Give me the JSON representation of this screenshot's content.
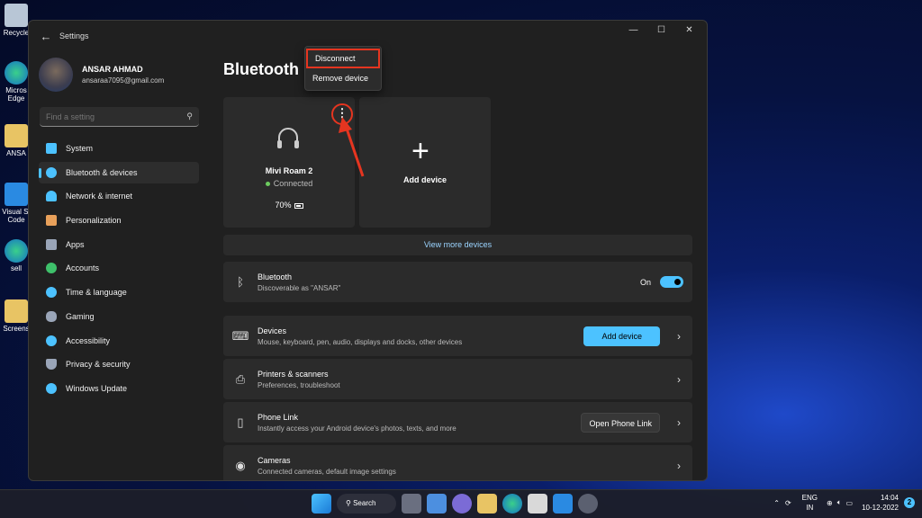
{
  "desktop": {
    "icons": [
      {
        "label": "Recycle",
        "icon": "recycle-bin-icon"
      },
      {
        "label": "Micros Edge",
        "icon": "edge-icon"
      },
      {
        "label": "ANSA",
        "icon": "folder-icon"
      },
      {
        "label": "Visual St Code",
        "icon": "vscode-icon"
      },
      {
        "label": "sell",
        "icon": "edge-icon"
      },
      {
        "label": "Screens",
        "icon": "folder-icon"
      }
    ]
  },
  "window": {
    "app_title": "Settings",
    "controls": {
      "minimize": "—",
      "maximize": "☐",
      "close": "✕"
    },
    "back": "←"
  },
  "profile": {
    "name": "ANSAR AHMAD",
    "email": "ansaraa7095@gmail.com"
  },
  "search": {
    "placeholder": "Find a setting"
  },
  "nav": [
    {
      "label": "System",
      "icon": "monitor-icon",
      "color": "#4cc2ff"
    },
    {
      "label": "Bluetooth & devices",
      "icon": "bluetooth-icon",
      "color": "#4cc2ff",
      "active": true
    },
    {
      "label": "Network & internet",
      "icon": "wifi-icon",
      "color": "#4cc2ff"
    },
    {
      "label": "Personalization",
      "icon": "brush-icon",
      "color": "#e8a05a"
    },
    {
      "label": "Apps",
      "icon": "apps-icon",
      "color": "#9aa5b8"
    },
    {
      "label": "Accounts",
      "icon": "person-icon",
      "color": "#3ec06a"
    },
    {
      "label": "Time & language",
      "icon": "globe-clock-icon",
      "color": "#4cc2ff"
    },
    {
      "label": "Gaming",
      "icon": "gamepad-icon",
      "color": "#9aa5b8"
    },
    {
      "label": "Accessibility",
      "icon": "accessibility-icon",
      "color": "#4cc2ff"
    },
    {
      "label": "Privacy & security",
      "icon": "shield-icon",
      "color": "#9aa5b8"
    },
    {
      "label": "Windows Update",
      "icon": "update-icon",
      "color": "#4cc2ff"
    }
  ],
  "page": {
    "title": "Bluetooth",
    "device_card": {
      "name": "Mivi Roam 2",
      "status": "Connected",
      "battery": "70%",
      "more": "⋮"
    },
    "add_card": {
      "plus": "+",
      "label": "Add device"
    },
    "view_more": "View more devices",
    "bluetooth_row": {
      "title": "Bluetooth",
      "subtitle": "Discoverable as \"ANSAR\"",
      "toggle_label": "On"
    },
    "rows": [
      {
        "title": "Devices",
        "subtitle": "Mouse, keyboard, pen, audio, displays and docks, other devices",
        "button": "Add device",
        "icon": "devices-icon"
      },
      {
        "title": "Printers & scanners",
        "subtitle": "Preferences, troubleshoot",
        "icon": "printer-icon"
      },
      {
        "title": "Phone Link",
        "subtitle": "Instantly access your Android device's photos, texts, and more",
        "button": "Open Phone Link",
        "icon": "phone-icon"
      },
      {
        "title": "Cameras",
        "subtitle": "Connected cameras, default image settings",
        "icon": "camera-icon"
      }
    ]
  },
  "context_menu": {
    "items": [
      "Disconnect",
      "Remove device"
    ]
  },
  "taskbar": {
    "search_label": "Search",
    "lang_top": "ENG",
    "lang_bottom": "IN",
    "time": "14:04",
    "date": "10-12-2022",
    "badge": "2"
  },
  "colors": {
    "accent": "#4cc2ff",
    "highlight": "#e53520"
  }
}
